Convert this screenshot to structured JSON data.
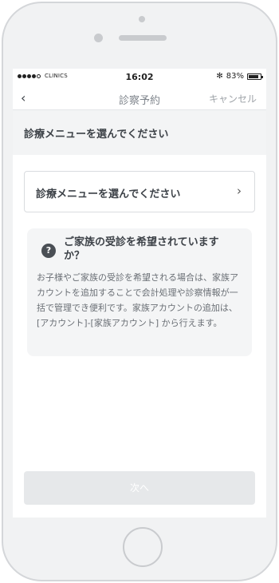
{
  "status_bar": {
    "carrier": "CLINICS",
    "time": "16:02",
    "bluetooth": "✻",
    "battery_percent": "83%"
  },
  "nav": {
    "back_icon": "‹",
    "title": "診察予約",
    "cancel_label": "キャンセル"
  },
  "section": {
    "header": "診療メニューを選んでください"
  },
  "menu_select": {
    "label": "診療メニューを選んでください",
    "chevron": "›"
  },
  "info": {
    "icon": "?",
    "title": "ご家族の受診を希望されていますか？",
    "body": "お子様やご家族の受診を希望される場合は、家族アカウントを追加することで会計処理や診察情報が一括で管理でき便利です。家族アカウントの追加は、[アカウント]-[家族アカウント] から行えます。"
  },
  "next_button": {
    "label": "次へ"
  }
}
